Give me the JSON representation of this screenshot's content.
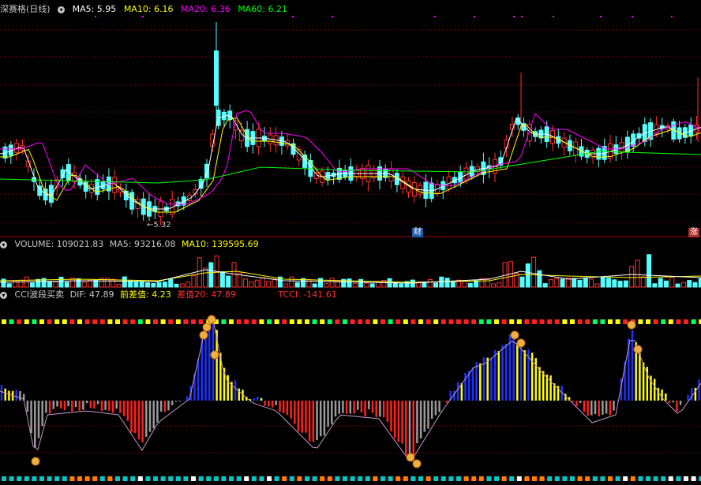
{
  "price_panel": {
    "title": "深赛格(日线)",
    "ma5": "MA5: 5.95",
    "ma10": "MA10: 6.16",
    "ma20": "MA20: 6.36",
    "ma60": "MA60: 6.21",
    "low_label": "5.32",
    "marker_cai": "财",
    "marker_zhang": "涨",
    "colors": {
      "ma5": "#ffffff",
      "ma10": "#ffff00",
      "ma20": "#ff00ff",
      "ma60": "#00ff00",
      "up": "#ff3232",
      "down": "#54ffff"
    }
  },
  "volume_panel": {
    "volume": "VOLUME: 109021.83",
    "ma5": "MA5: 93216.08",
    "ma10": "MA10: 139595.69"
  },
  "cci_panel": {
    "name": "CCI波段买卖",
    "dif": "DIF: 47.89",
    "qiancha": "前差值: 4.23",
    "chazhi": "差值20: 47.89",
    "tcci": "TCCI: -141.61"
  }
}
